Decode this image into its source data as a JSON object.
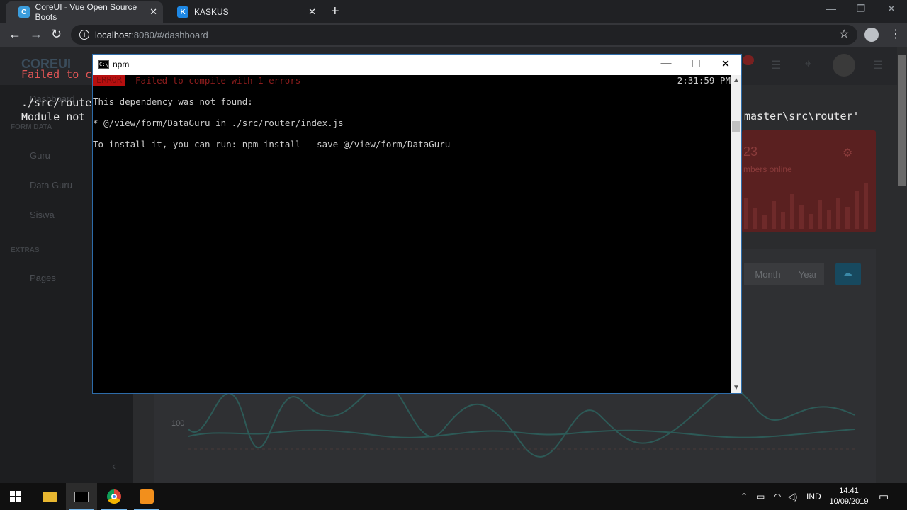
{
  "browser": {
    "tabs": [
      {
        "title": "CoreUI - Vue Open Source Boots",
        "favicon": "coreui-icon",
        "active": true
      },
      {
        "title": "KASKUS",
        "favicon": "kaskus-icon",
        "active": false
      }
    ],
    "url_host": "localhost",
    "url_rest": ":8080/#/dashboard"
  },
  "page": {
    "logo": "COREUI",
    "overlay_error": "Failed to c",
    "overlay_lines": [
      "./src/route",
      "Module not"
    ],
    "overlay_right": "master\\src\\router'",
    "sidebar": {
      "dashboard": "Dashboard",
      "section_form": "FORM DATA",
      "items": [
        "Guru",
        "Data Guru",
        "Siswa"
      ],
      "section_extras": "EXTRAS",
      "extras_items": [
        "Pages"
      ]
    },
    "card": {
      "number": "23",
      "subtitle": "mbers online"
    },
    "segments": [
      "Month",
      "Year"
    ],
    "y_tick": "100"
  },
  "npm_window": {
    "title": "npm",
    "error_badge": "ERROR",
    "error_message": "Failed to compile with 1 errors",
    "time": "2:31:59 PM",
    "lines": [
      "This dependency was not found:",
      "* @/view/form/DataGuru in ./src/router/index.js",
      "To install it, you can run: npm install --save @/view/form/DataGuru"
    ]
  },
  "taskbar": {
    "language": "IND",
    "time": "14.41",
    "date": "10/09/2019"
  }
}
